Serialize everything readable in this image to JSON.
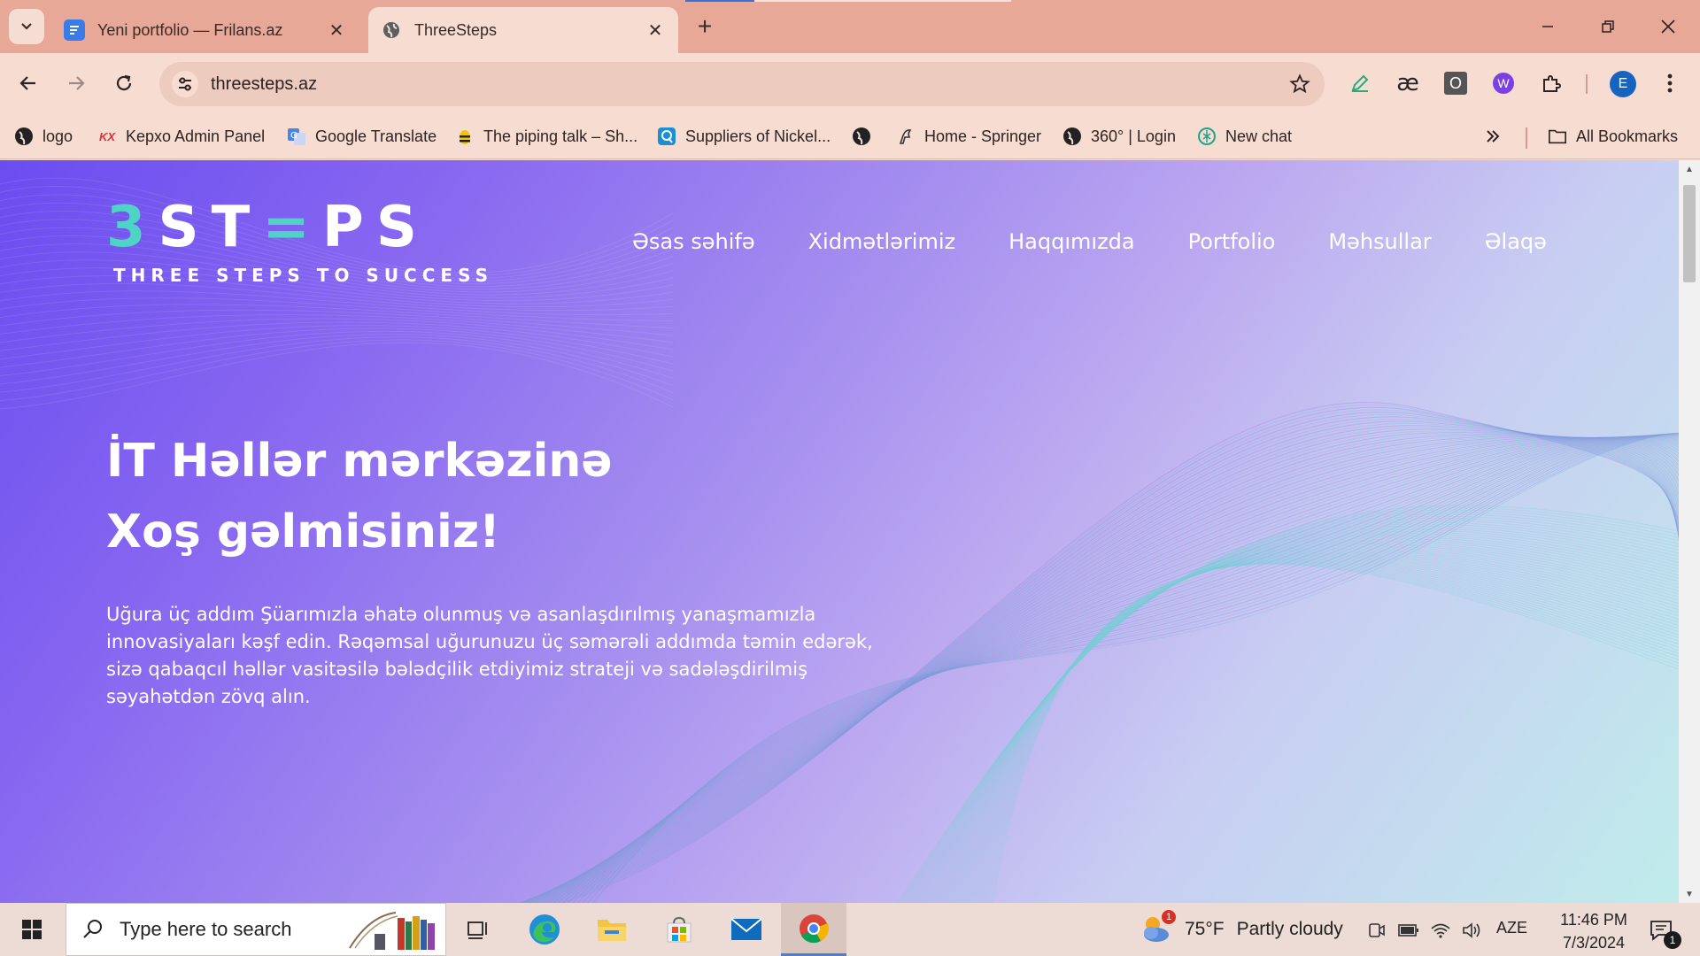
{
  "browser": {
    "tabs": [
      {
        "title": "Yeni portfolio — Frilans.az",
        "active": false,
        "favicon": "frilans-icon"
      },
      {
        "title": "ThreeSteps",
        "active": true,
        "favicon": "globe-icon"
      }
    ],
    "close_glyph": "✕",
    "new_tab_glyph": "+",
    "address": "threesteps.az",
    "profile_initial": "E"
  },
  "bookmarks": [
    {
      "label": "logo",
      "icon": "globe-icon"
    },
    {
      "label": "Kepxo Admin Panel",
      "icon": "kepxo-icon"
    },
    {
      "label": "Google Translate",
      "icon": "translate-icon"
    },
    {
      "label": "The piping talk – Sh...",
      "icon": "bee-icon"
    },
    {
      "label": "Suppliers of Nickel...",
      "icon": "q-icon"
    },
    {
      "label": "Home - Springer",
      "icon": "springer-icon"
    },
    {
      "label": "360° | Login",
      "icon": "globe-icon"
    },
    {
      "label": "New chat",
      "icon": "chatgpt-icon"
    }
  ],
  "all_bookmarks": "All Bookmarks",
  "site": {
    "logo_main_parts": [
      "3",
      "ST",
      "=",
      "PS"
    ],
    "logo_tagline": "THREE STEPS TO SUCCESS",
    "nav": [
      "Əsas səhifə",
      "Xidmətlərimiz",
      "Haqqımızda",
      "Portfolio",
      "Məhsullar",
      "Əlaqə"
    ],
    "hero_line1": "İT Həllər mərkəzinə",
    "hero_line2": "Xoş gəlmisiniz!",
    "hero_paragraph": "Uğura üç addım Şüarımızla əhatə olunmuş və asanlaşdırılmış yanaşmamızla innovasiyaları kəşf edin. Rəqəmsal uğurunuzu üç səmərəli addımda təmin edərək, sizə qabaqcıl həllər vasitəsilə bələdçilik etdiyimiz strateji və sadələşdirilmiş səyahətdən zövq alın."
  },
  "taskbar": {
    "search_placeholder": "Type here to search",
    "weather_temp": "75°F",
    "weather_desc": "Partly cloudy",
    "weather_badge": "1",
    "language": "AZE",
    "time": "11:46 PM",
    "date": "7/3/2024",
    "notification_count": "1"
  },
  "colors": {
    "accent_teal": "#4fd3c4",
    "hero_gradient_start": "#6a4df0",
    "hero_gradient_end": "#bfeceb",
    "tab_strip": "#e8a898"
  }
}
